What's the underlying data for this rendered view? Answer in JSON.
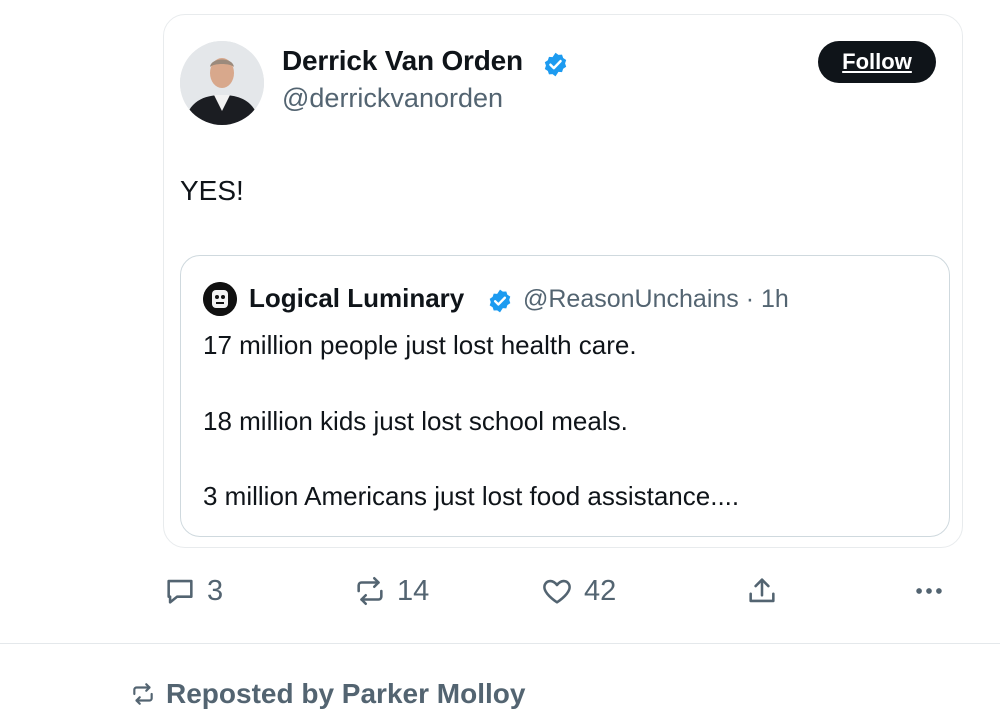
{
  "post": {
    "author_name": "Derrick Van Orden",
    "author_handle": "@derrickvanorden",
    "follow_label": "Follow",
    "text": "YES!"
  },
  "quoted_post": {
    "author_name": "Logical Luminary",
    "author_handle": "@ReasonUnchains",
    "time": "1h",
    "lines": [
      "17 million people just lost health care.",
      "18 million kids just lost school meals.",
      "3 million Americans just lost food assistance...."
    ]
  },
  "actions": {
    "replies": "3",
    "reposts": "14",
    "likes": "42"
  },
  "repost_banner": "Reposted by Parker Molloy",
  "colors": {
    "text": "#0f1419",
    "secondary": "#536471",
    "verified": "#1d9bf0",
    "follow_bg": "#0f1419"
  },
  "icons": [
    "reply-icon",
    "repost-icon",
    "like-icon",
    "share-icon",
    "more-icon",
    "verified-icon"
  ]
}
